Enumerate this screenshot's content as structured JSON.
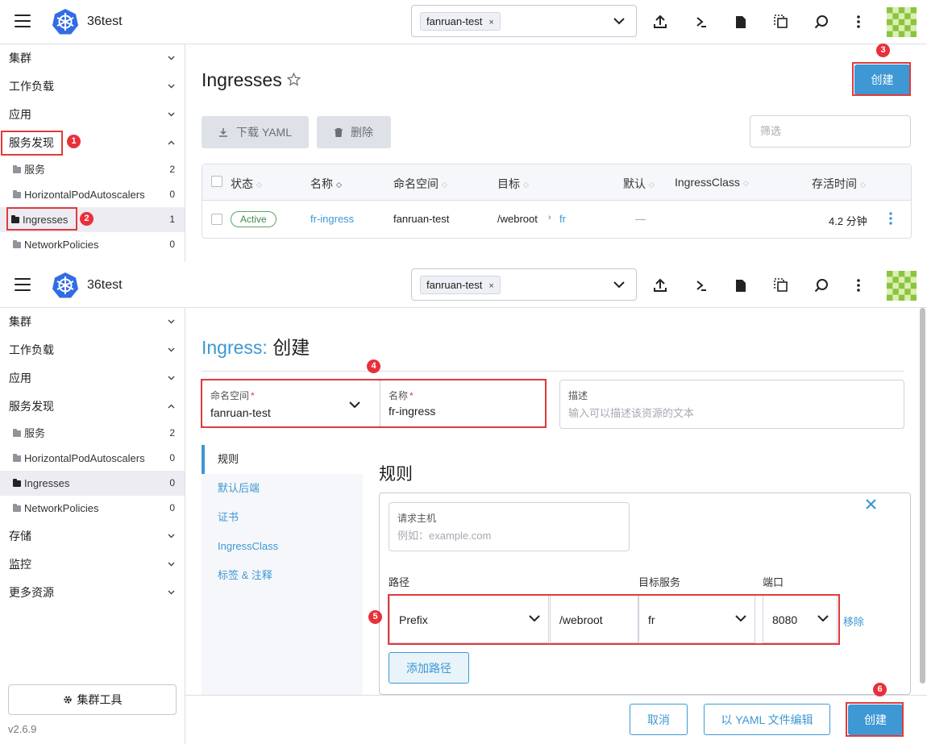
{
  "header": {
    "cluster_name": "36test",
    "namespace_chip": "fanruan-test",
    "chip_close": "×"
  },
  "sidebar": {
    "groups": {
      "cluster": "集群",
      "workload": "工作负载",
      "apps": "应用",
      "service_discovery": "服务发现",
      "storage": "存储",
      "monitoring": "监控",
      "more": "更多资源"
    },
    "items": [
      {
        "label": "服务",
        "count": "2"
      },
      {
        "label": "HorizontalPodAutoscalers",
        "count": "0"
      },
      {
        "label": "Ingresses",
        "count": "1"
      },
      {
        "label": "NetworkPolicies",
        "count": "0"
      }
    ],
    "cluster_tools": "集群工具",
    "version": "v2.6.9"
  },
  "list_page": {
    "title": "Ingresses",
    "create_button": "创建",
    "download_yaml": "下载 YAML",
    "delete": "删除",
    "filter_placeholder": "筛选",
    "columns": [
      "状态",
      "名称",
      "命名空间",
      "目标",
      "默认",
      "IngressClass",
      "存活时间"
    ],
    "rows": [
      {
        "status": "Active",
        "name": "fr-ingress",
        "namespace": "fanruan-test",
        "target_path": "/webroot",
        "target_service": "fr",
        "default": "—",
        "age": "4.2 分钟"
      }
    ]
  },
  "create_page": {
    "title_prefix": "Ingress:",
    "title_suffix": "创建",
    "namespace_label": "命名空间",
    "namespace_value": "fanruan-test",
    "name_label": "名称",
    "name_value": "fr-ingress",
    "required_mark": "*",
    "desc_label": "描述",
    "desc_placeholder": "输入可以描述该资源的文本",
    "tabs": [
      "规则",
      "默认后端",
      "证书",
      "IngressClass",
      "标签 & 注释"
    ],
    "rules_heading": "规则",
    "host_label": "请求主机",
    "host_placeholder": "例如：example.com",
    "path_label": "路径",
    "target_label": "目标服务",
    "port_label": "端口",
    "path_type": "Prefix",
    "path_value": "/webroot",
    "target_service": "fr",
    "port": "8080",
    "remove": "移除",
    "add_path": "添加路径",
    "cancel": "取消",
    "edit_yaml": "以 YAML 文件编辑",
    "create": "创建"
  },
  "annotations": [
    "1",
    "2",
    "3",
    "4",
    "5",
    "6"
  ],
  "colors": {
    "accent": "#3d98d3",
    "highlight": "#e03b3b",
    "active_green": "#3c8b4d"
  }
}
